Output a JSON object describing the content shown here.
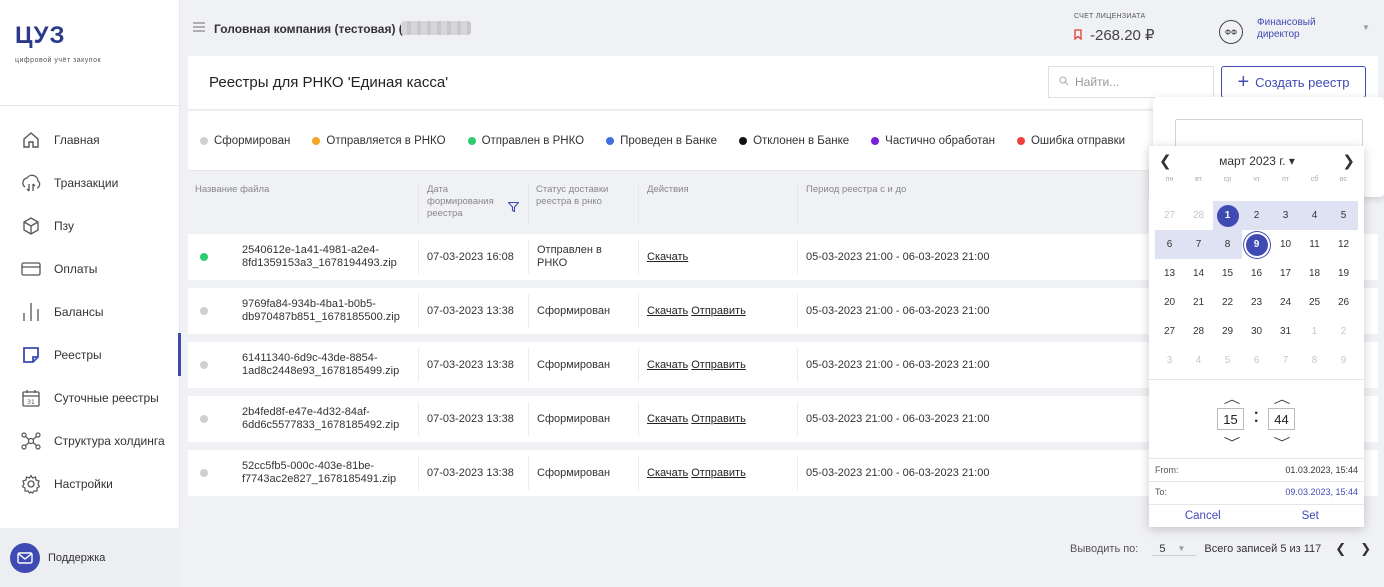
{
  "brand": {
    "logo": "ЦУЗ",
    "subtitle": "цифровой учёт закупок"
  },
  "sidebar": {
    "items": [
      {
        "label": "Главная",
        "icon": "home-icon"
      },
      {
        "label": "Транзакции",
        "icon": "transactions-icon"
      },
      {
        "label": "Пзу",
        "icon": "box-icon"
      },
      {
        "label": "Оплаты",
        "icon": "card-icon"
      },
      {
        "label": "Балансы",
        "icon": "bars-icon"
      },
      {
        "label": "Реестры",
        "icon": "registry-icon",
        "active": true
      },
      {
        "label": "Суточные реестры",
        "icon": "calendar-icon"
      },
      {
        "label": "Структура холдинга",
        "icon": "hierarchy-icon"
      },
      {
        "label": "Настройки",
        "icon": "gear-icon"
      }
    ],
    "support_label": "Поддержка"
  },
  "header": {
    "company": "Головная компания (тестовая) (79",
    "account_label": "СЧЕТ ЛИЦЕНЗИАТА",
    "account_value": "-268.20 ₽",
    "avatar_initials": "ФФ",
    "role": "Финансовый директор"
  },
  "page": {
    "title": "Реестры для РНКО 'Единая касса'",
    "search_placeholder": "Найти...",
    "create_label": "Создать реестр"
  },
  "legend": [
    {
      "label": "Сформирован",
      "color": "#d0d0d0"
    },
    {
      "label": "Отправляется в РНКО",
      "color": "#f5a623"
    },
    {
      "label": "Отправлен в РНКО",
      "color": "#2ecc71"
    },
    {
      "label": "Проведен в Банке",
      "color": "#3f6fe0"
    },
    {
      "label": "Отклонен в Банке",
      "color": "#111111"
    },
    {
      "label": "Частично обработан",
      "color": "#7b1fe0"
    },
    {
      "label": "Ошибка отправки",
      "color": "#f04040"
    }
  ],
  "table": {
    "headers": {
      "file": "Название файла",
      "date": "Дата формирования реестра",
      "status": "Статус доставки реестра в рнко",
      "actions": "Действия",
      "period": "Период реестра с и до"
    },
    "download_label": "Скачать",
    "send_label": "Отправить",
    "rows": [
      {
        "file": "2540612e-1a41-4981-a2e4-8fd1359153a3_1678194493.zip",
        "date": "07-03-2023 16:08",
        "status": "Отправлен в РНКО",
        "period": "05-03-2023 21:00 - 06-03-2023 21:00",
        "dot": "#2ecc71",
        "send": false
      },
      {
        "file": "9769fa84-934b-4ba1-b0b5-db970487b851_1678185500.zip",
        "date": "07-03-2023 13:38",
        "status": "Сформирован",
        "period": "05-03-2023 21:00 - 06-03-2023 21:00",
        "dot": "#d0d0d0",
        "send": true
      },
      {
        "file": "61411340-6d9c-43de-8854-1ad8c2448e93_1678185499.zip",
        "date": "07-03-2023 13:38",
        "status": "Сформирован",
        "period": "05-03-2023 21:00 - 06-03-2023 21:00",
        "dot": "#d0d0d0",
        "send": true
      },
      {
        "file": "2b4fed8f-e47e-4d32-84af-6dd6c5577833_1678185492.zip",
        "date": "07-03-2023 13:38",
        "status": "Сформирован",
        "period": "05-03-2023 21:00 - 06-03-2023 21:00",
        "dot": "#d0d0d0",
        "send": true
      },
      {
        "file": "52cc5fb5-000c-403e-81be-f7743ac2e827_1678185491.zip",
        "date": "07-03-2023 13:38",
        "status": "Сформирован",
        "period": "05-03-2023 21:00 - 06-03-2023 21:00",
        "dot": "#d0d0d0",
        "send": true
      }
    ]
  },
  "pager": {
    "label": "Выводить по:",
    "per_page": "5",
    "total": "Всего записей 5 из 117"
  },
  "datepicker": {
    "month": "март 2023 г.",
    "weekdays": [
      "пн",
      "вт",
      "ср",
      "чт",
      "пт",
      "сб",
      "вс"
    ],
    "days": [
      {
        "d": "27",
        "m": true
      },
      {
        "d": "28",
        "m": true
      },
      {
        "d": "1",
        "sel": true,
        "r": true
      },
      {
        "d": "2",
        "r": true
      },
      {
        "d": "3",
        "r": true
      },
      {
        "d": "4",
        "r": true
      },
      {
        "d": "5",
        "r": true
      },
      {
        "d": "6",
        "r": true
      },
      {
        "d": "7",
        "r": true
      },
      {
        "d": "8",
        "r": true
      },
      {
        "d": "9",
        "sel": true,
        "ring": true
      },
      {
        "d": "10"
      },
      {
        "d": "11"
      },
      {
        "d": "12"
      },
      {
        "d": "13"
      },
      {
        "d": "14"
      },
      {
        "d": "15"
      },
      {
        "d": "16"
      },
      {
        "d": "17"
      },
      {
        "d": "18"
      },
      {
        "d": "19"
      },
      {
        "d": "20"
      },
      {
        "d": "21"
      },
      {
        "d": "22"
      },
      {
        "d": "23"
      },
      {
        "d": "24"
      },
      {
        "d": "25"
      },
      {
        "d": "26"
      },
      {
        "d": "27"
      },
      {
        "d": "28"
      },
      {
        "d": "29"
      },
      {
        "d": "30"
      },
      {
        "d": "31"
      },
      {
        "d": "1",
        "m": true
      },
      {
        "d": "2",
        "m": true
      },
      {
        "d": "3",
        "m": true
      },
      {
        "d": "4",
        "m": true
      },
      {
        "d": "5",
        "m": true
      },
      {
        "d": "6",
        "m": true
      },
      {
        "d": "7",
        "m": true
      },
      {
        "d": "8",
        "m": true
      },
      {
        "d": "9",
        "m": true
      }
    ],
    "hour": "15",
    "minute": "44",
    "from_label": "From:",
    "from_value": "01.03.2023, 15:44",
    "to_label": "To:",
    "to_value": "09.03.2023, 15:44",
    "cancel_label": "Cancel",
    "set_label": "Set"
  }
}
